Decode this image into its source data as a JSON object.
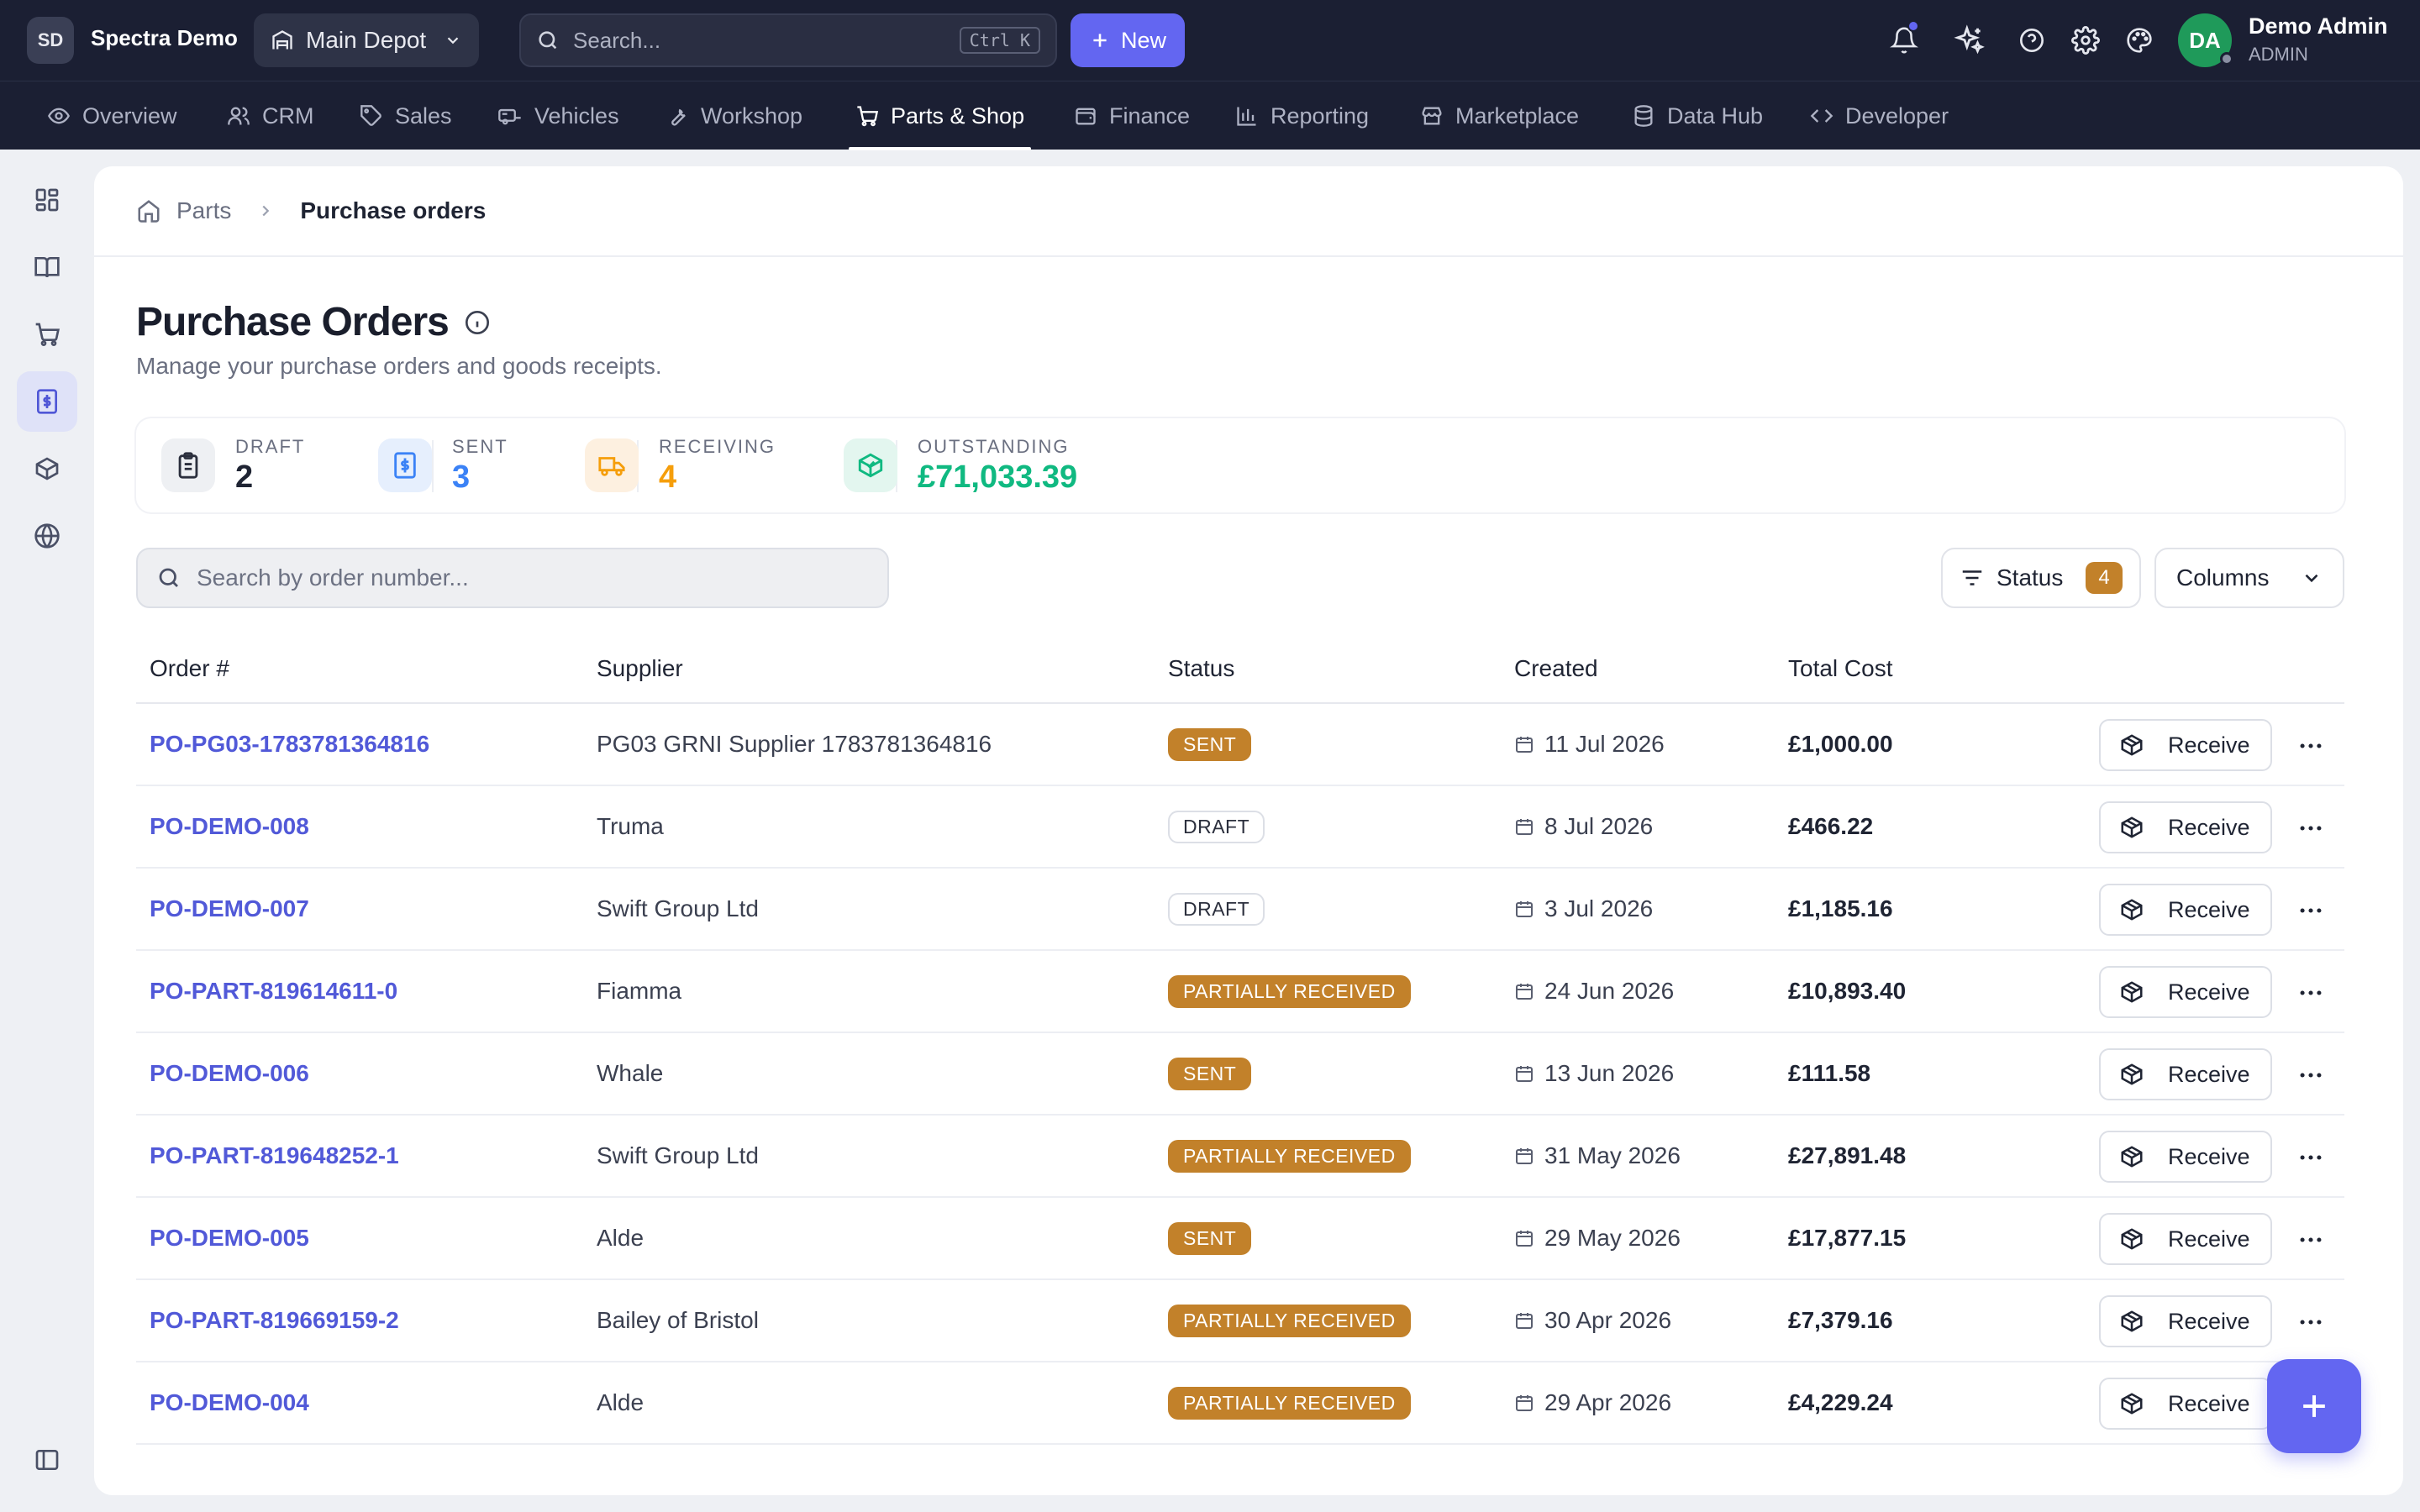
{
  "header": {
    "org_initials": "SD",
    "org_name": "Spectra Demo",
    "depot": "Main Depot",
    "search_placeholder": "Search...",
    "search_shortcut": "Ctrl K",
    "new_label": "New",
    "user_initials": "DA",
    "user_name": "Demo Admin",
    "user_role": "ADMIN"
  },
  "nav": {
    "tabs": [
      {
        "label": "Overview",
        "icon": "eye-icon"
      },
      {
        "label": "CRM",
        "icon": "users-icon"
      },
      {
        "label": "Sales",
        "icon": "tag-icon"
      },
      {
        "label": "Vehicles",
        "icon": "caravan-icon"
      },
      {
        "label": "Workshop",
        "icon": "wrench-icon"
      },
      {
        "label": "Parts & Shop",
        "icon": "cart-icon",
        "active": true
      },
      {
        "label": "Finance",
        "icon": "wallet-icon"
      },
      {
        "label": "Reporting",
        "icon": "bar-chart-icon"
      },
      {
        "label": "Marketplace",
        "icon": "store-icon"
      },
      {
        "label": "Data Hub",
        "icon": "database-icon"
      },
      {
        "label": "Developer",
        "icon": "code-icon"
      }
    ]
  },
  "breadcrumb": {
    "parent": "Parts",
    "current": "Purchase orders"
  },
  "page": {
    "title": "Purchase Orders",
    "subtitle": "Manage your purchase orders and goods receipts."
  },
  "stats": [
    {
      "label": "Draft",
      "value": "2",
      "color": "#1f2433"
    },
    {
      "label": "Sent",
      "value": "3",
      "color": "#3b82f6"
    },
    {
      "label": "Receiving",
      "value": "4",
      "color": "#f59e0b"
    },
    {
      "label": "Outstanding",
      "value": "£71,033.39",
      "color": "#10b981"
    }
  ],
  "filters": {
    "search_placeholder": "Search by order number...",
    "status_label": "Status",
    "status_count": "4",
    "columns_label": "Columns"
  },
  "table": {
    "columns": [
      "Order #",
      "Supplier",
      "Status",
      "Created",
      "Total Cost"
    ],
    "action_label": "Receive",
    "rows": [
      {
        "order": "PO-PG03-1783781364816",
        "supplier": "PG03 GRNI Supplier 1783781364816",
        "status": "SENT",
        "status_type": "sent",
        "created": "11 Jul 2026",
        "total": "£1,000.00"
      },
      {
        "order": "PO-DEMO-008",
        "supplier": "Truma",
        "status": "DRAFT",
        "status_type": "draft",
        "created": "8 Jul 2026",
        "total": "£466.22"
      },
      {
        "order": "PO-DEMO-007",
        "supplier": "Swift Group Ltd",
        "status": "DRAFT",
        "status_type": "draft",
        "created": "3 Jul 2026",
        "total": "£1,185.16"
      },
      {
        "order": "PO-PART-819614611-0",
        "supplier": "Fiamma",
        "status": "PARTIALLY RECEIVED",
        "status_type": "partial",
        "created": "24 Jun 2026",
        "total": "£10,893.40"
      },
      {
        "order": "PO-DEMO-006",
        "supplier": "Whale",
        "status": "SENT",
        "status_type": "sent",
        "created": "13 Jun 2026",
        "total": "£111.58"
      },
      {
        "order": "PO-PART-819648252-1",
        "supplier": "Swift Group Ltd",
        "status": "PARTIALLY RECEIVED",
        "status_type": "partial",
        "created": "31 May 2026",
        "total": "£27,891.48"
      },
      {
        "order": "PO-DEMO-005",
        "supplier": "Alde",
        "status": "SENT",
        "status_type": "sent",
        "created": "29 May 2026",
        "total": "£17,877.15"
      },
      {
        "order": "PO-PART-819669159-2",
        "supplier": "Bailey of Bristol",
        "status": "PARTIALLY RECEIVED",
        "status_type": "partial",
        "created": "30 Apr 2026",
        "total": "£7,379.16"
      },
      {
        "order": "PO-DEMO-004",
        "supplier": "Alde",
        "status": "PARTIALLY RECEIVED",
        "status_type": "partial",
        "created": "29 Apr 2026",
        "total": "£4,229.24"
      }
    ]
  },
  "colors": {
    "accent": "#6366f1",
    "warning_badge": "#c2812a",
    "link": "#5159d8"
  }
}
